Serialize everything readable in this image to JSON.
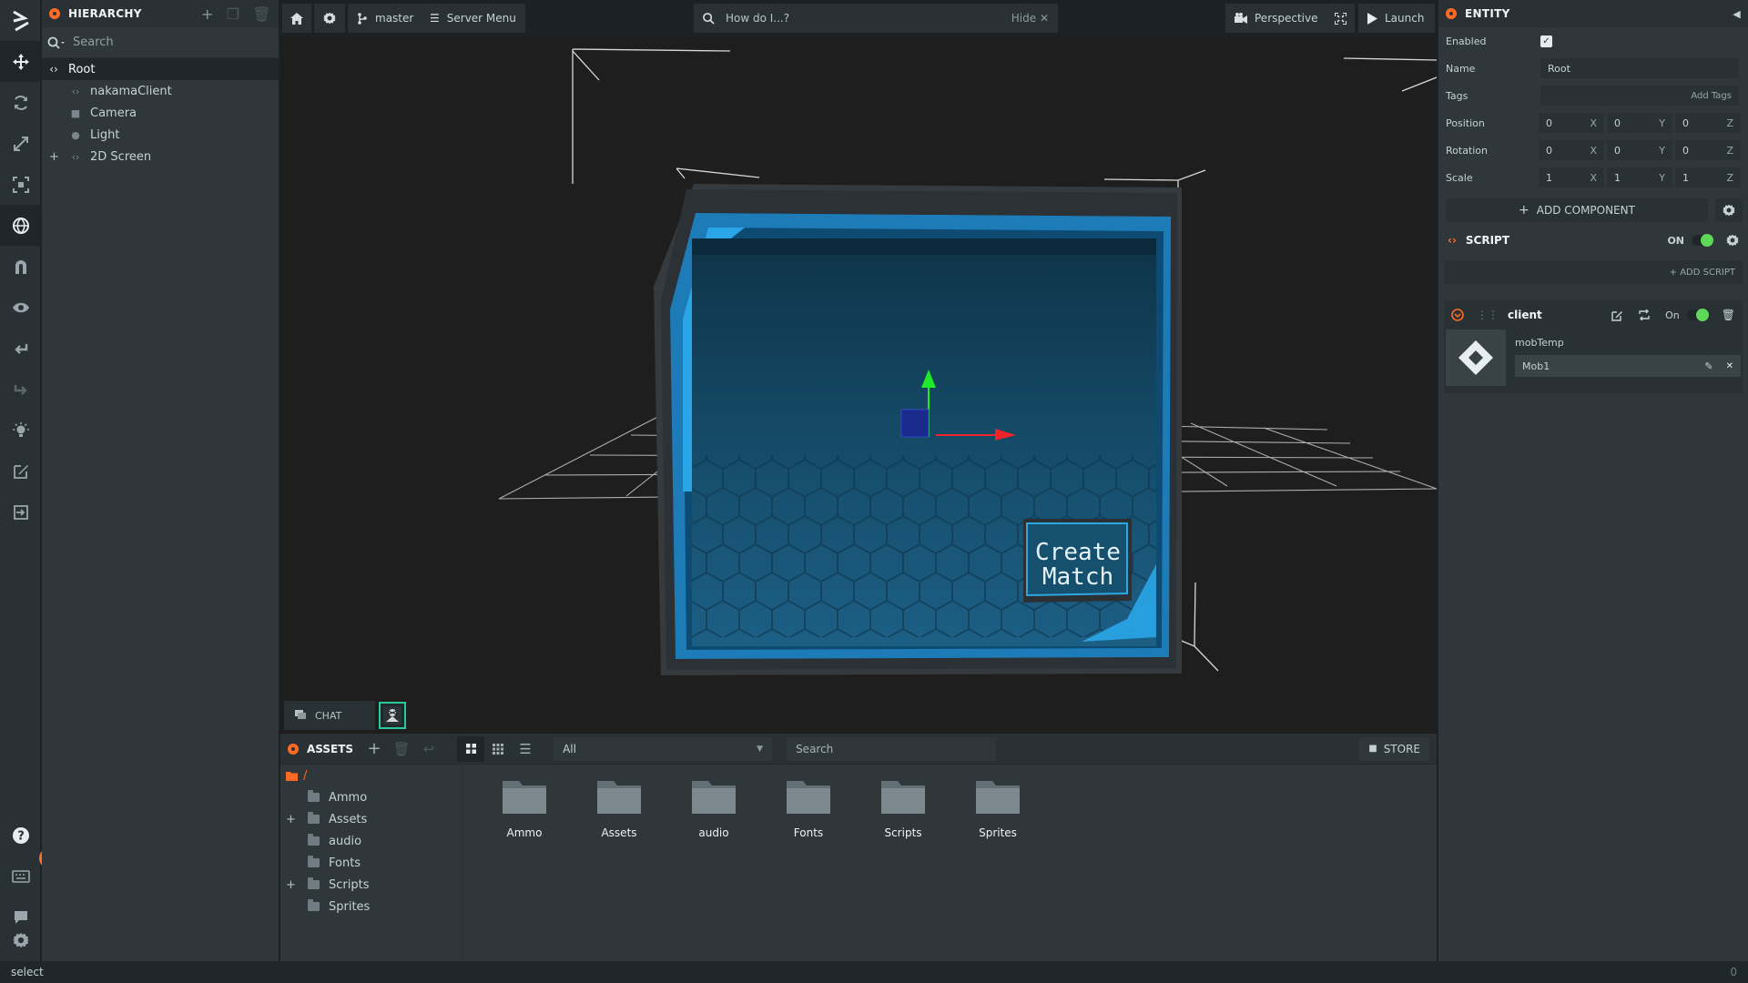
{
  "hierarchy": {
    "title": "HIERARCHY",
    "search_placeholder": "Search",
    "root": "Root",
    "children": [
      "nakamaClient",
      "Camera",
      "Light",
      "2D Screen"
    ]
  },
  "topbar": {
    "branch": "master",
    "server_menu": "Server Menu",
    "help_placeholder": "How do I...?",
    "hide": "Hide",
    "camera": "Perspective",
    "launch": "Launch"
  },
  "viewport": {
    "button_line1": "Create",
    "button_line2": "Match",
    "chat": "CHAT"
  },
  "assets": {
    "title": "ASSETS",
    "filter": "All",
    "search_placeholder": "Search",
    "store": "STORE",
    "root_path": "/",
    "folders": [
      "Ammo",
      "Assets",
      "audio",
      "Fonts",
      "Scripts",
      "Sprites"
    ]
  },
  "inspector": {
    "title": "ENTITY",
    "enabled_label": "Enabled",
    "name_label": "Name",
    "name_value": "Root",
    "tags_label": "Tags",
    "add_tags": "Add Tags",
    "position_label": "Position",
    "rotation_label": "Rotation",
    "scale_label": "Scale",
    "position": [
      "0",
      "0",
      "0"
    ],
    "rotation": [
      "0",
      "0",
      "0"
    ],
    "scale": [
      "1",
      "1",
      "1"
    ],
    "axes": [
      "X",
      "Y",
      "Z"
    ],
    "add_component": "ADD COMPONENT",
    "script_title": "SCRIPT",
    "script_on": "ON",
    "add_script": "+ ADD SCRIPT",
    "script_name": "client",
    "script_toggle": "On",
    "attr_name": "mobTemp",
    "attr_value": "Mob1"
  },
  "status": {
    "text": "select",
    "count": "0"
  },
  "colors": {
    "accent": "#ff6b24",
    "toggle_on": "#5ed858",
    "teal": "#29c99c"
  }
}
